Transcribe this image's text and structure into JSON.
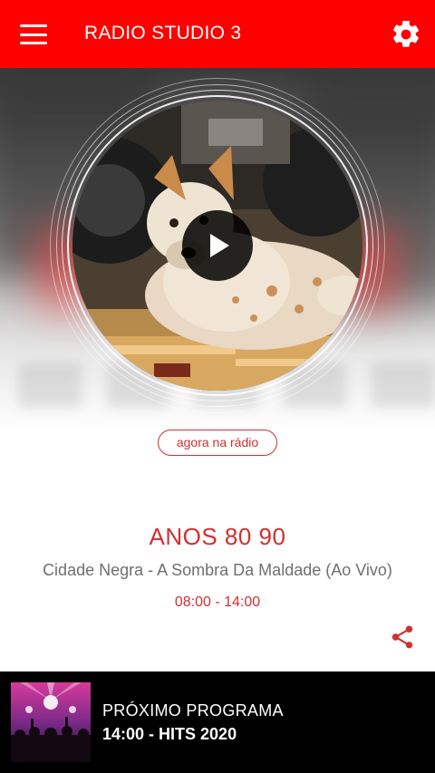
{
  "appbar": {
    "title": "RADIO STUDIO 3",
    "menu_icon": "hamburger-menu-icon",
    "settings_icon": "gear-icon",
    "background_color": "#ff0000"
  },
  "player": {
    "cover_description_icon": "album-art",
    "play_icon": "play-icon",
    "now_playing_badge": "agora na rádio",
    "program_name": "ANOS 80 90",
    "track": "Cidade Negra - A Sombra Da Maldade (Ao Vivo)",
    "time_range": "08:00 - 14:00",
    "share_icon": "share-icon",
    "accent_color": "#d32f2f"
  },
  "next_program": {
    "label": "PRÓXIMO PROGRAMA",
    "title": "14:00 - HITS 2020",
    "thumb_icon": "concert-thumbnail"
  }
}
